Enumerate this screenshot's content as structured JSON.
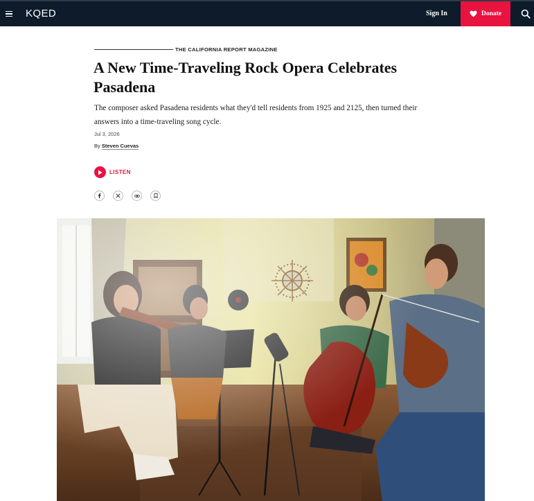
{
  "header": {
    "logo": "KQED",
    "signin_label": "Sign In",
    "donate_label": "Donate",
    "brand_color": "#e8133f",
    "bar_color": "#0d1b2a"
  },
  "article": {
    "section": "THE CALIFORNIA REPORT MAGAZINE",
    "title": "A New Time-Traveling Rock Opera Celebrates Pasadena",
    "dek": "The composer asked Pasadena residents what they'd tell residents from 1925 and 2125, then turned their answers into a time-traveling song cycle.",
    "date": "Jul 3, 2026",
    "byline_prefix": "By",
    "author": "Steven Cuevas",
    "listen_label": "LISTEN"
  },
  "share": {
    "icons": [
      "facebook-icon",
      "x-icon",
      "link-icon",
      "bookmark-icon"
    ]
  }
}
